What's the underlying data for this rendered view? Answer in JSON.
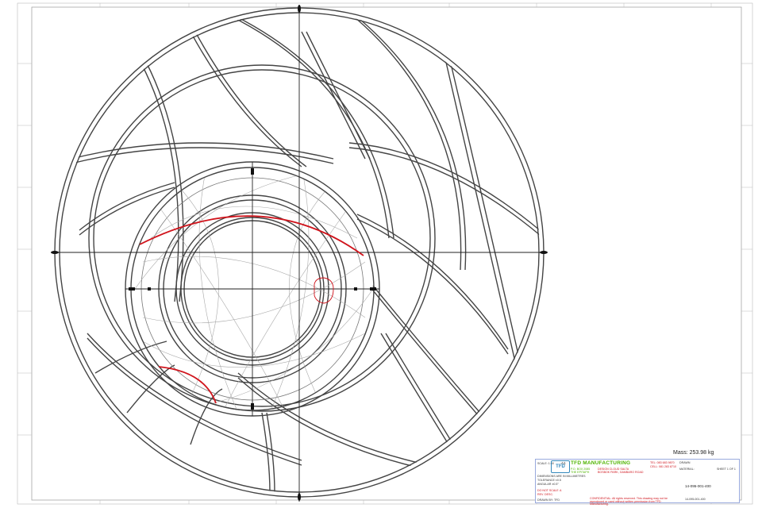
{
  "drawing": {
    "mass_label": "Mass: 253.98 kg"
  },
  "title_block": {
    "company": "TFD MANUFACTURING",
    "logo_text": "TFD",
    "address_1": "P.O. BOX 2085",
    "address_2": "THE EPITAPH",
    "phone": "TEL: 083 683 9870",
    "fax": "CELL: 081 283 8710",
    "site_1": "DESIGN CLOUD SALTA",
    "site_2": "BOSBOK PARK, GAMBARO ROAD",
    "scale_label": "SCALE: 1:50",
    "size_label": "A1",
    "tolerance_1": "DIMENSIONS ARE IN MILLIMETRES",
    "tolerance_2": "TOLERANCE ±0.5",
    "tolerance_3": "ANGULAR ±0.5°",
    "tolerance_4": "DO NOT SCALE",
    "tolerance_5": "REV. DESC.",
    "drawn_label": "DRAWN",
    "material_label": "MATERIAL:",
    "sheet_label": "SHEET 1 OF 1",
    "part_number": "14-095-001-400",
    "drawing_number": "14-095-001-400",
    "rev_label": "A",
    "copyright": "CONFIDENTIAL: All rights reserved. This drawing may not be reproduced or used without written permission from TFD Manufacturing.",
    "drawn_by": "DRAWN BY: TFD"
  }
}
